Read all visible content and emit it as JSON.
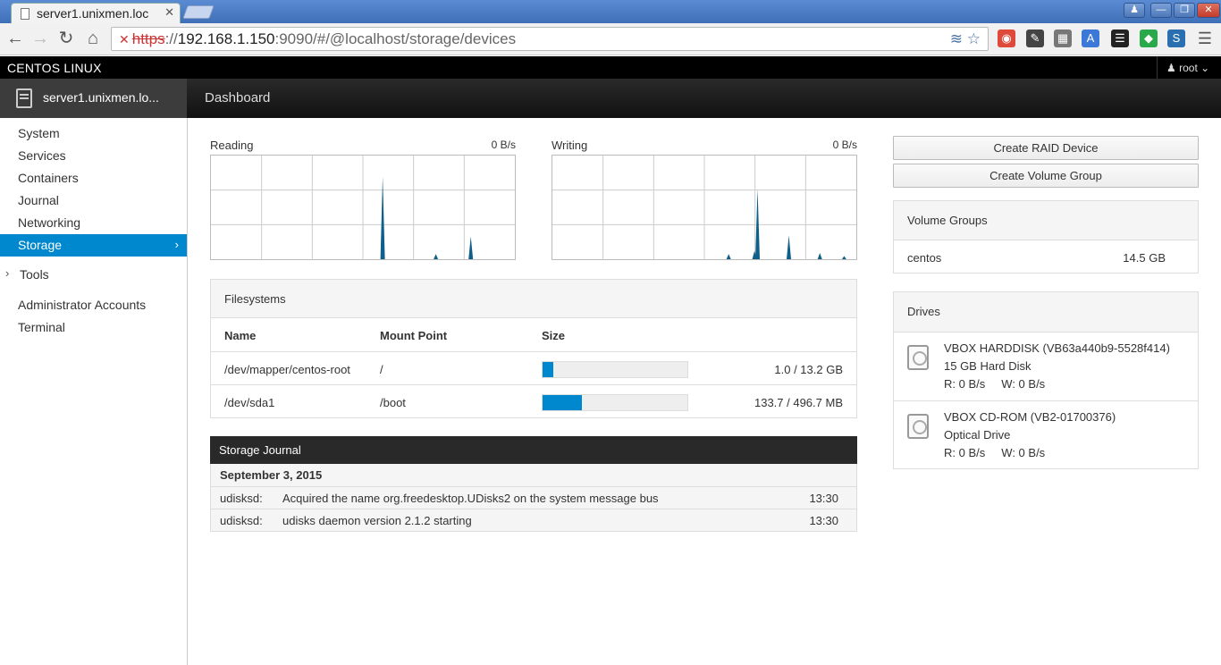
{
  "browser": {
    "tab_title": "server1.unixmen.loc",
    "url_scheme": "https",
    "url_host": "192.168.1.150",
    "url_rest": ":9090/#/@localhost/storage/devices",
    "url_sep": "://"
  },
  "cockpit": {
    "brand": "CENTOS LINUX",
    "user": "root",
    "host": "server1.unixmen.lo...",
    "page": "Dashboard"
  },
  "sidebar": {
    "items": [
      {
        "label": "System"
      },
      {
        "label": "Services"
      },
      {
        "label": "Containers"
      },
      {
        "label": "Journal"
      },
      {
        "label": "Networking"
      },
      {
        "label": "Storage"
      },
      {
        "label": "Tools"
      },
      {
        "label": "Administrator Accounts"
      },
      {
        "label": "Terminal"
      }
    ]
  },
  "graphs": {
    "reading": {
      "label": "Reading",
      "value": "0 B/s",
      "spikes": [
        [
          0.565,
          0.8
        ],
        [
          0.74,
          0.05
        ],
        [
          0.855,
          0.22
        ]
      ]
    },
    "writing": {
      "label": "Writing",
      "value": "0 B/s",
      "spikes": [
        [
          0.58,
          0.05
        ],
        [
          0.665,
          0.08
        ],
        [
          0.675,
          0.68
        ],
        [
          0.778,
          0.23
        ],
        [
          0.88,
          0.06
        ],
        [
          0.96,
          0.03
        ]
      ]
    }
  },
  "filesystems": {
    "title": "Filesystems",
    "headers": {
      "name": "Name",
      "mount": "Mount Point",
      "size": "Size"
    },
    "rows": [
      {
        "name": "/dev/mapper/centos-root",
        "mount": "/",
        "size_text": "1.0 / 13.2 GB",
        "fraction": 0.076
      },
      {
        "name": "/dev/sda1",
        "mount": "/boot",
        "size_text": "133.7 / 496.7 MB",
        "fraction": 0.269
      }
    ]
  },
  "journal": {
    "title": "Storage Journal",
    "date": "September 3, 2015",
    "entries": [
      {
        "source": "udisksd:",
        "message": "Acquired the name org.freedesktop.UDisks2 on the system message bus",
        "time": "13:30"
      },
      {
        "source": "udisksd:",
        "message": "udisks daemon version 2.1.2 starting",
        "time": "13:30"
      }
    ]
  },
  "actions": {
    "raid": "Create RAID Device",
    "vg": "Create Volume Group"
  },
  "volume_groups": {
    "title": "Volume Groups",
    "items": [
      {
        "name": "centos",
        "size": "14.5 GB"
      }
    ]
  },
  "drives": {
    "title": "Drives",
    "items": [
      {
        "name": "VBOX HARDDISK (VB63a440b9-5528f414)",
        "desc": "15 GB Hard Disk",
        "rw": "R: 0 B/s     W: 0 B/s"
      },
      {
        "name": "VBOX CD-ROM (VB2-01700376)",
        "desc": "Optical Drive",
        "rw": "R: 0 B/s     W: 0 B/s"
      }
    ]
  },
  "colors": {
    "accent": "#0088ce",
    "dark": "#000000",
    "chart_line": "#0e5f8a"
  }
}
